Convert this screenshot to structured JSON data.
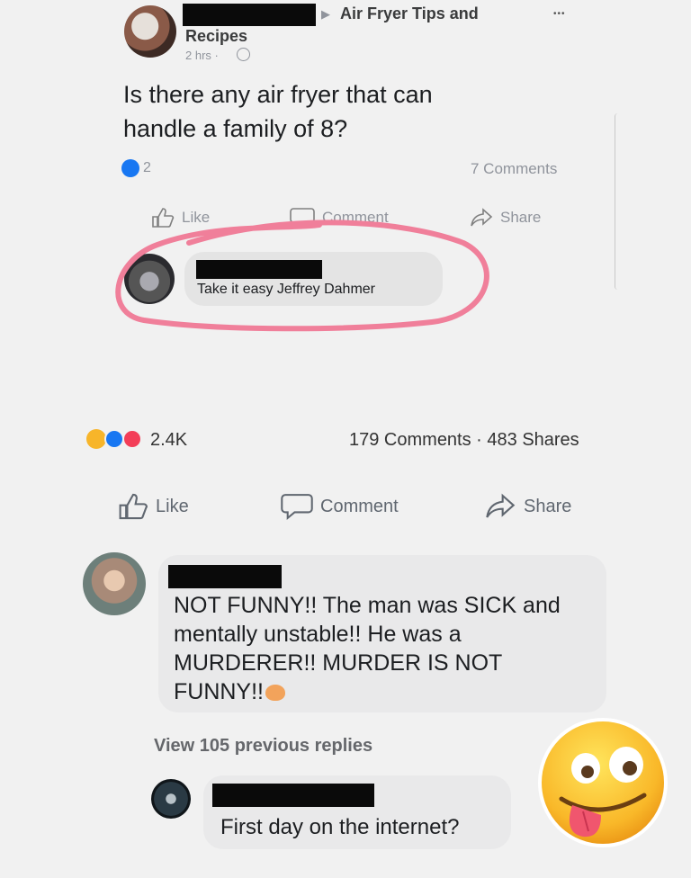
{
  "inner_post": {
    "group_arrow": "▶",
    "group_name_line1": "Air Fryer Tips and",
    "group_name_line2": "Recipes",
    "time": "2 hrs ·",
    "more": "•••",
    "text_line1": "Is there any air fryer that can",
    "text_line2": "handle a family of 8?",
    "reaction_count": "2",
    "comments_count": "7 Comments",
    "actions": {
      "like": "Like",
      "comment": "Comment",
      "share": "Share"
    },
    "comment": {
      "text": "Take it easy Jeffrey Dahmer"
    },
    "highlight_color": "#f07f9a"
  },
  "outer_post": {
    "reaction_count": "2.4K",
    "stats": "179 Comments · 483 Shares",
    "actions": {
      "like": "Like",
      "comment": "Comment",
      "share": "Share"
    },
    "comment": {
      "line1": "NOT FUNNY!! The man was SICK and",
      "line2": "mentally unstable!! He was a",
      "line3": "MURDERER!! MURDER IS NOT",
      "line4": "FUNNY!!"
    },
    "view_replies": "View 105 previous replies",
    "reply": {
      "text": "First day on the internet?"
    }
  },
  "colors": {
    "like_blue": "#1877f2",
    "love_red": "#f33e58",
    "emoji_yellow": "#f7b52a"
  }
}
